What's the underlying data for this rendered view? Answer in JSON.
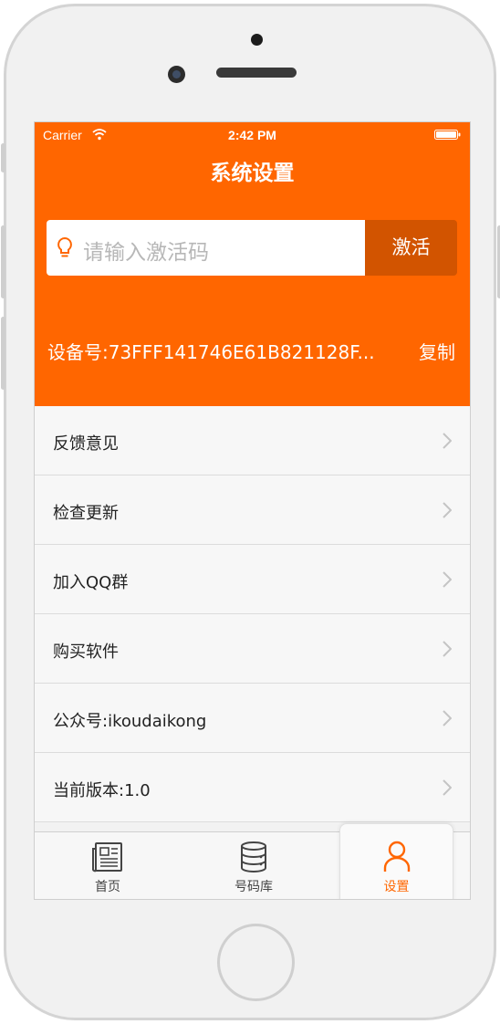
{
  "statusbar": {
    "carrier": "Carrier",
    "time": "2:42 PM"
  },
  "header": {
    "title": "系统设置",
    "search_placeholder": "请输入激活码",
    "activate_label": "激活",
    "device_id": "设备号:73FFF141746E61B821128F...",
    "copy_label": "复制"
  },
  "menu": {
    "items": [
      {
        "label": "反馈意见"
      },
      {
        "label": "检查更新"
      },
      {
        "label": "加入QQ群"
      },
      {
        "label": "购买软件"
      },
      {
        "label": "公众号:ikoudaikong"
      },
      {
        "label": "当前版本:1.0"
      }
    ]
  },
  "tabbar": {
    "tabs": [
      {
        "label": "首页",
        "icon": "newspaper-icon"
      },
      {
        "label": "号码库",
        "icon": "database-icon"
      },
      {
        "label": "设置",
        "icon": "user-icon",
        "active": true
      }
    ]
  },
  "colors": {
    "accent": "#ff6600",
    "button_dark": "#d25400",
    "background": "#f2f2f2"
  }
}
